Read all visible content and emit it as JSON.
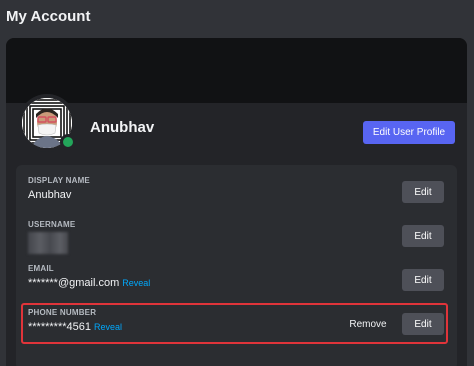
{
  "page": {
    "title": "My Account"
  },
  "profile": {
    "name": "Anubhav",
    "edit_button": "Edit User Profile",
    "status_color": "#23a55a"
  },
  "fields": [
    {
      "label": "DISPLAY NAME",
      "value": "Anubhav",
      "edit": "Edit"
    },
    {
      "label": "USERNAME",
      "value": "",
      "blurred": true,
      "edit": "Edit"
    },
    {
      "label": "EMAIL",
      "value": "*******@gmail.com",
      "reveal": "Reveal",
      "edit": "Edit"
    },
    {
      "label": "PHONE NUMBER",
      "value": "*********4561",
      "reveal": "Reveal",
      "remove": "Remove",
      "edit": "Edit",
      "highlighted": true
    }
  ],
  "colors": {
    "accent": "#5865f2",
    "link": "#00a8fc",
    "highlight": "#e0343a"
  }
}
